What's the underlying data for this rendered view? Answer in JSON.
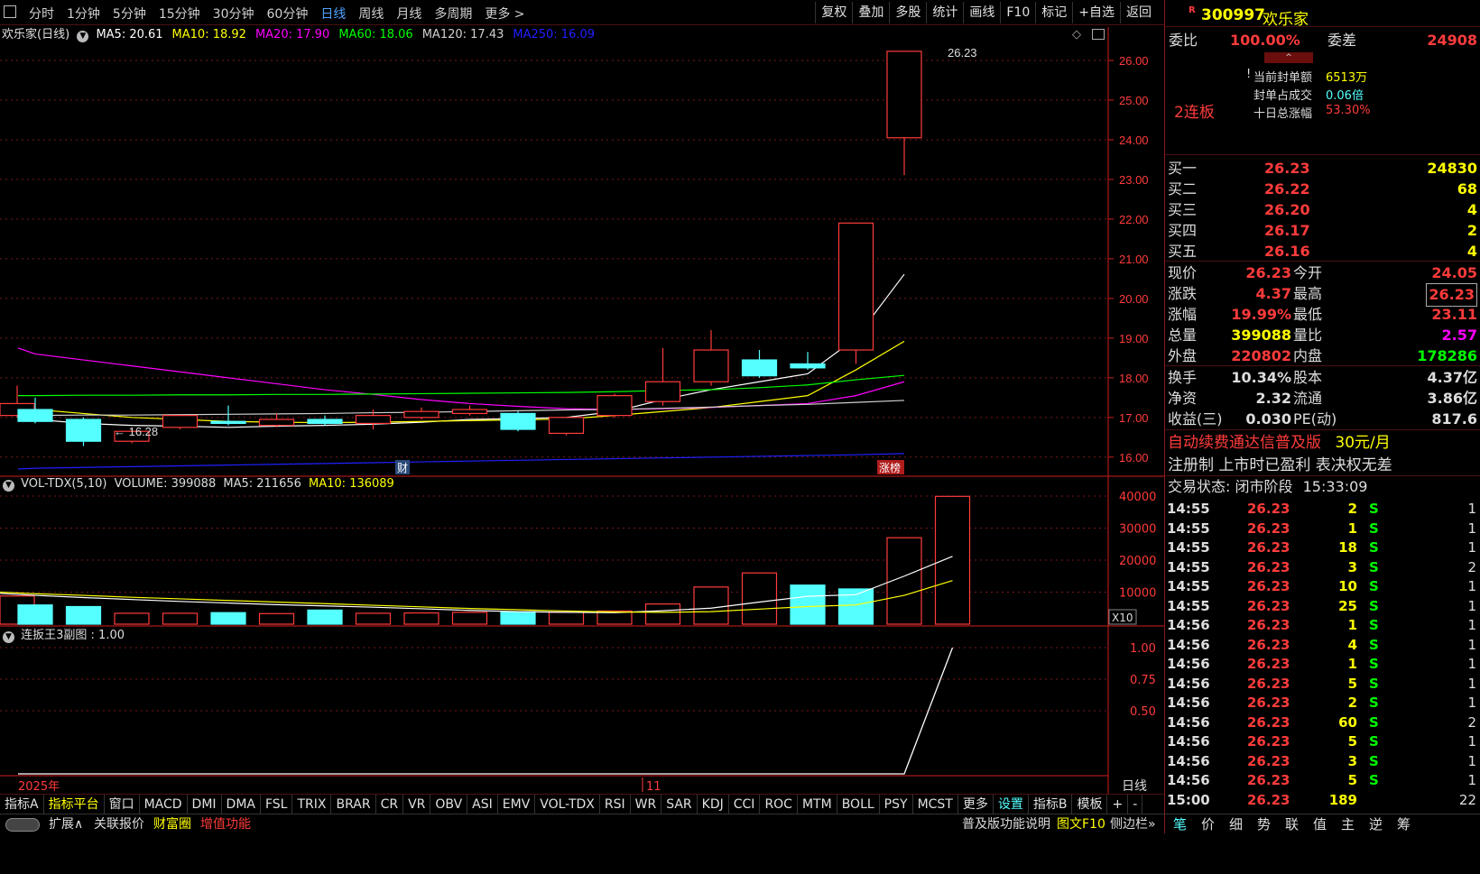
{
  "toolbar": {
    "periods": [
      "分时",
      "1分钟",
      "5分钟",
      "15分钟",
      "30分钟",
      "60分钟",
      "日线",
      "周线",
      "月线",
      "多周期",
      "更多 >"
    ],
    "active_period": "日线",
    "right_buttons": [
      "复权",
      "叠加",
      "多股",
      "统计",
      "画线",
      "F10",
      "标记",
      "+自选",
      "返回"
    ]
  },
  "stock": {
    "code": "300997",
    "name": "欢乐家",
    "title": "欢乐家(日线)"
  },
  "ma_legend": [
    {
      "label": "MA5: 20.61",
      "color": "#ffffff"
    },
    {
      "label": "MA10: 18.92",
      "color": "#ffff00"
    },
    {
      "label": "MA20: 17.90",
      "color": "#ff00ff"
    },
    {
      "label": "MA60: 18.06",
      "color": "#00ff00"
    },
    {
      "label": "MA120: 17.43",
      "color": "#d0d0d0"
    },
    {
      "label": "MA250: 16.09",
      "color": "#2020ff"
    }
  ],
  "price_axis": [
    "26.00",
    "25.00",
    "24.00",
    "23.00",
    "22.00",
    "21.00",
    "20.00",
    "19.00",
    "18.00",
    "17.00",
    "16.00"
  ],
  "annotations": {
    "high": "26.23",
    "low": "16.28",
    "cai": "财",
    "zhangbang": "涨榜"
  },
  "vol_legend": {
    "name": "VOL-TDX(5,10)",
    "volume": "VOLUME: 399088",
    "ma5": "MA5: 211656",
    "ma10": "MA10: 136089"
  },
  "vol_axis": [
    "40000",
    "30000",
    "20000",
    "10000"
  ],
  "vol_unit": "X10",
  "ind_legend": "连扳王3副图 : 1.00",
  "ind_axis": [
    "1.00",
    "0.75",
    "0.50"
  ],
  "date_labels": {
    "year": "2025年",
    "month": "11",
    "period": "日线"
  },
  "chart_data": {
    "type": "candlestick",
    "candles": [
      {
        "o": 17.35,
        "h": 17.8,
        "c": 17.05,
        "l": 17.0,
        "up": true
      },
      {
        "o": 17.2,
        "h": 17.5,
        "c": 16.9,
        "l": 16.85,
        "up": false
      },
      {
        "o": 16.95,
        "h": 17.0,
        "c": 16.4,
        "l": 16.28,
        "up": false
      },
      {
        "o": 16.4,
        "h": 16.7,
        "c": 16.65,
        "l": 16.35,
        "up": true
      },
      {
        "o": 16.75,
        "h": 17.0,
        "c": 17.05,
        "l": 16.7,
        "up": true
      },
      {
        "o": 16.9,
        "h": 17.3,
        "c": 16.85,
        "l": 16.8,
        "up": false
      },
      {
        "o": 16.8,
        "h": 17.1,
        "c": 16.95,
        "l": 16.75,
        "up": true
      },
      {
        "o": 16.95,
        "h": 17.05,
        "c": 16.85,
        "l": 16.8,
        "up": false
      },
      {
        "o": 16.85,
        "h": 17.2,
        "c": 17.05,
        "l": 16.7,
        "up": true
      },
      {
        "o": 17.0,
        "h": 17.25,
        "c": 17.15,
        "l": 16.95,
        "up": true
      },
      {
        "o": 17.1,
        "h": 17.3,
        "c": 17.2,
        "l": 17.05,
        "up": true
      },
      {
        "o": 17.1,
        "h": 17.15,
        "c": 16.7,
        "l": 16.65,
        "up": false
      },
      {
        "o": 16.6,
        "h": 17.0,
        "c": 17.0,
        "l": 16.55,
        "up": true
      },
      {
        "o": 17.05,
        "h": 17.6,
        "c": 17.55,
        "l": 17.0,
        "up": true
      },
      {
        "o": 17.4,
        "h": 18.75,
        "c": 17.9,
        "l": 17.3,
        "up": true
      },
      {
        "o": 17.9,
        "h": 19.2,
        "c": 18.7,
        "l": 17.8,
        "up": true
      },
      {
        "o": 18.45,
        "h": 18.7,
        "c": 18.05,
        "l": 18.0,
        "up": false
      },
      {
        "o": 18.35,
        "h": 18.65,
        "c": 18.25,
        "l": 18.2,
        "up": false
      },
      {
        "o": 18.7,
        "h": 21.9,
        "c": 21.9,
        "l": 18.35,
        "up": true
      },
      {
        "o": 24.05,
        "h": 26.23,
        "c": 26.23,
        "l": 23.11,
        "up": true
      }
    ],
    "ma_lines": {
      "MA5": [
        17.0,
        16.95,
        16.85,
        16.8,
        16.78,
        16.75,
        16.78,
        16.8,
        16.83,
        16.88,
        16.95,
        16.97,
        17.0,
        17.15,
        17.45,
        17.7,
        17.9,
        18.1,
        19.0,
        20.61
      ],
      "MA10": [
        17.3,
        17.2,
        17.1,
        17.0,
        16.95,
        16.9,
        16.88,
        16.87,
        16.88,
        16.9,
        16.92,
        16.94,
        16.96,
        17.05,
        17.15,
        17.25,
        17.4,
        17.55,
        18.2,
        18.92
      ],
      "MA20": [
        18.75,
        18.6,
        18.45,
        18.3,
        18.15,
        18.0,
        17.85,
        17.7,
        17.58,
        17.45,
        17.35,
        17.28,
        17.22,
        17.2,
        17.22,
        17.25,
        17.3,
        17.35,
        17.55,
        17.9
      ],
      "MA60": [
        17.55,
        17.55,
        17.56,
        17.56,
        17.57,
        17.57,
        17.58,
        17.58,
        17.59,
        17.6,
        17.61,
        17.62,
        17.63,
        17.65,
        17.68,
        17.7,
        17.75,
        17.82,
        17.95,
        18.06
      ],
      "MA120": [
        17.05,
        17.05,
        17.06,
        17.06,
        17.07,
        17.08,
        17.09,
        17.1,
        17.12,
        17.13,
        17.15,
        17.17,
        17.19,
        17.2,
        17.23,
        17.26,
        17.3,
        17.33,
        17.38,
        17.43
      ],
      "MA250": [
        15.7,
        15.72,
        15.74,
        15.76,
        15.78,
        15.8,
        15.82,
        15.84,
        15.86,
        15.88,
        15.9,
        15.92,
        15.94,
        15.96,
        15.98,
        16.0,
        16.02,
        16.04,
        16.06,
        16.09
      ]
    },
    "volume": [
      8800,
      6000,
      5500,
      3400,
      3400,
      3600,
      3300,
      4400,
      3400,
      3500,
      3700,
      3900,
      3700,
      4100,
      6300,
      11600,
      16000,
      12200,
      11000,
      27000,
      39908
    ],
    "vol_up": [
      true,
      false,
      false,
      true,
      true,
      false,
      true,
      false,
      true,
      true,
      true,
      false,
      true,
      true,
      true,
      true,
      true,
      false,
      false,
      true,
      true
    ],
    "vol_ma5": [
      9600,
      9000,
      8300,
      7700,
      7100,
      6600,
      6100,
      5700,
      5300,
      4800,
      4300,
      3900,
      3700,
      3600,
      4200,
      5000,
      6900,
      8700,
      9200,
      15000,
      21166
    ],
    "vol_ma10": [
      10000,
      9500,
      9000,
      8400,
      7900,
      7400,
      6900,
      6400,
      5900,
      5400,
      4900,
      4500,
      4100,
      3800,
      3700,
      3900,
      4700,
      5500,
      6000,
      9000,
      13609
    ],
    "ind_values": [
      0,
      0,
      0,
      0,
      0,
      0,
      0,
      0,
      0,
      0,
      0,
      0,
      0,
      0,
      0,
      0,
      0,
      0,
      0,
      0,
      1.0
    ],
    "ylim_price": [
      15.7,
      26.5
    ],
    "ylim_vol": [
      0,
      40000
    ],
    "ylim_ind": [
      0,
      1.0
    ]
  },
  "quote": {
    "weibi_label": "委比",
    "weibi": "100.00%",
    "weicha_label": "委差",
    "weicha": "24908",
    "seal_label": "当前封单额",
    "seal": "6513万",
    "seal_ratio_label": "封单占成交",
    "seal_ratio": "0.06倍",
    "ten_day_label": "十日总涨幅",
    "ten_day": "53.30%",
    "lianban": "2连板",
    "buys": [
      {
        "label": "买一",
        "price": "26.23",
        "vol": "24830"
      },
      {
        "label": "买二",
        "price": "26.22",
        "vol": "68"
      },
      {
        "label": "买三",
        "price": "26.20",
        "vol": "4"
      },
      {
        "label": "买四",
        "price": "26.17",
        "vol": "2"
      },
      {
        "label": "买五",
        "price": "26.16",
        "vol": "4"
      }
    ],
    "stats": [
      {
        "l1": "现价",
        "v1": "26.23",
        "l2": "今开",
        "v2": "24.05",
        "c1": "#ff3b3b",
        "c2": "#ff3b3b"
      },
      {
        "l1": "涨跌",
        "v1": "4.37",
        "l2": "最高",
        "v2": "26.23",
        "c1": "#ff3b3b",
        "c2": "#ff3b3b"
      },
      {
        "l1": "涨幅",
        "v1": "19.99%",
        "l2": "最低",
        "v2": "23.11",
        "c1": "#ff3b3b",
        "c2": "#ff3b3b"
      },
      {
        "l1": "总量",
        "v1": "399088",
        "l2": "量比",
        "v2": "2.57",
        "c1": "#ffff00",
        "c2": "#ff00ff"
      },
      {
        "l1": "外盘",
        "v1": "220802",
        "l2": "内盘",
        "v2": "178286",
        "c1": "#ff3b3b",
        "c2": "#00ff00"
      }
    ],
    "stats2": [
      {
        "l1": "换手",
        "v1": "10.34%",
        "l2": "股本",
        "v2": "4.37亿"
      },
      {
        "l1": "净资",
        "v1": "2.32",
        "l2": "流通",
        "v2": "3.86亿"
      },
      {
        "l1": "收益(三)",
        "v1": "0.030",
        "l2": "PE(动)",
        "v2": "817.6"
      }
    ],
    "ad1": "自动续费通达信普及版",
    "ad1_price": "30元/月",
    "ad2": "注册制 上市时已盈利 表决权无差",
    "trade_status": "交易状态: 闭市阶段",
    "trade_time": "15:33:09"
  },
  "ticks": [
    {
      "t": "14:55",
      "p": "26.23",
      "v": "2",
      "s": "S",
      "n": "1"
    },
    {
      "t": "14:55",
      "p": "26.23",
      "v": "1",
      "s": "S",
      "n": "1"
    },
    {
      "t": "14:55",
      "p": "26.23",
      "v": "18",
      "s": "S",
      "n": "1"
    },
    {
      "t": "14:55",
      "p": "26.23",
      "v": "3",
      "s": "S",
      "n": "2"
    },
    {
      "t": "14:55",
      "p": "26.23",
      "v": "10",
      "s": "S",
      "n": "1"
    },
    {
      "t": "14:55",
      "p": "26.23",
      "v": "25",
      "s": "S",
      "n": "1"
    },
    {
      "t": "14:56",
      "p": "26.23",
      "v": "1",
      "s": "S",
      "n": "1"
    },
    {
      "t": "14:56",
      "p": "26.23",
      "v": "4",
      "s": "S",
      "n": "1"
    },
    {
      "t": "14:56",
      "p": "26.23",
      "v": "1",
      "s": "S",
      "n": "1"
    },
    {
      "t": "14:56",
      "p": "26.23",
      "v": "5",
      "s": "S",
      "n": "1"
    },
    {
      "t": "14:56",
      "p": "26.23",
      "v": "2",
      "s": "S",
      "n": "1"
    },
    {
      "t": "14:56",
      "p": "26.23",
      "v": "60",
      "s": "S",
      "n": "2"
    },
    {
      "t": "14:56",
      "p": "26.23",
      "v": "5",
      "s": "S",
      "n": "1"
    },
    {
      "t": "14:56",
      "p": "26.23",
      "v": "3",
      "s": "S",
      "n": "1"
    },
    {
      "t": "14:56",
      "p": "26.23",
      "v": "5",
      "s": "S",
      "n": "1"
    },
    {
      "t": "15:00",
      "p": "26.23",
      "v": "189",
      "s": "",
      "n": "22"
    }
  ],
  "indicator_tabs": [
    "指标A",
    "指标平台",
    "窗口",
    "MACD",
    "DMI",
    "DMA",
    "FSL",
    "TRIX",
    "BRAR",
    "CR",
    "VR",
    "OBV",
    "ASI",
    "EMV",
    "VOL-TDX",
    "RSI",
    "WR",
    "SAR",
    "KDJ",
    "CCI",
    "ROC",
    "MTM",
    "BOLL",
    "PSY",
    "MCST",
    "更多",
    "设置",
    "指标B",
    "模板",
    "+",
    "-"
  ],
  "bottom_bar": {
    "expand": "扩展∧",
    "related": "关联报价",
    "caifu": "财富圈",
    "zengzhi": "增值功能",
    "version": "普及版功能说明",
    "tuwen": "图文F10",
    "sidebar": "侧边栏»"
  },
  "right_tabs": [
    "笔",
    "价",
    "细",
    "势",
    "联",
    "值",
    "主",
    "逆",
    "筹"
  ],
  "colors": {
    "up": "#ff3b3b",
    "down": "#54ffff",
    "grid": "#7a1a1a",
    "axis": "#d21e1e"
  }
}
